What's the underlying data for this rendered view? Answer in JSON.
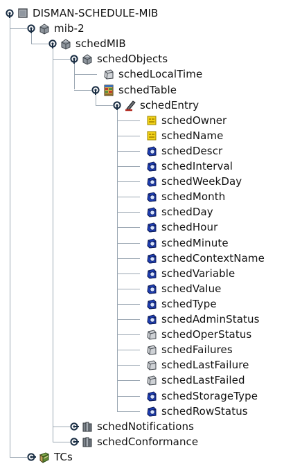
{
  "colors": {
    "connector": "#9aa6b2",
    "handle": "#1a2e44",
    "text": "#111111"
  },
  "tree": [
    {
      "label": "DISMAN-SCHEDULE-MIB",
      "depth": 0,
      "icon": "module-icon",
      "state": "expanded"
    },
    {
      "label": "mib-2",
      "depth": 1,
      "icon": "group-icon",
      "state": "expanded"
    },
    {
      "label": "schedMIB",
      "depth": 2,
      "icon": "group-icon",
      "state": "expanded"
    },
    {
      "label": "schedObjects",
      "depth": 3,
      "icon": "group-icon",
      "state": "expanded"
    },
    {
      "label": "schedLocalTime",
      "depth": 4,
      "icon": "scalar-icon",
      "state": "leaf"
    },
    {
      "label": "schedTable",
      "depth": 4,
      "icon": "table-icon",
      "state": "expanded"
    },
    {
      "label": "schedEntry",
      "depth": 5,
      "icon": "entry-icon",
      "state": "expanded"
    },
    {
      "label": "schedOwner",
      "depth": 6,
      "icon": "index-icon",
      "state": "leaf"
    },
    {
      "label": "schedName",
      "depth": 6,
      "icon": "index-icon",
      "state": "leaf"
    },
    {
      "label": "schedDescr",
      "depth": 6,
      "icon": "writable-column-icon",
      "state": "leaf"
    },
    {
      "label": "schedInterval",
      "depth": 6,
      "icon": "writable-column-icon",
      "state": "leaf"
    },
    {
      "label": "schedWeekDay",
      "depth": 6,
      "icon": "writable-column-icon",
      "state": "leaf"
    },
    {
      "label": "schedMonth",
      "depth": 6,
      "icon": "writable-column-icon",
      "state": "leaf"
    },
    {
      "label": "schedDay",
      "depth": 6,
      "icon": "writable-column-icon",
      "state": "leaf"
    },
    {
      "label": "schedHour",
      "depth": 6,
      "icon": "writable-column-icon",
      "state": "leaf"
    },
    {
      "label": "schedMinute",
      "depth": 6,
      "icon": "writable-column-icon",
      "state": "leaf"
    },
    {
      "label": "schedContextName",
      "depth": 6,
      "icon": "writable-column-icon",
      "state": "leaf"
    },
    {
      "label": "schedVariable",
      "depth": 6,
      "icon": "writable-column-icon",
      "state": "leaf"
    },
    {
      "label": "schedValue",
      "depth": 6,
      "icon": "writable-column-icon",
      "state": "leaf"
    },
    {
      "label": "schedType",
      "depth": 6,
      "icon": "writable-column-icon",
      "state": "leaf"
    },
    {
      "label": "schedAdminStatus",
      "depth": 6,
      "icon": "writable-column-icon",
      "state": "leaf"
    },
    {
      "label": "schedOperStatus",
      "depth": 6,
      "icon": "readonly-column-icon",
      "state": "leaf"
    },
    {
      "label": "schedFailures",
      "depth": 6,
      "icon": "readonly-column-icon",
      "state": "leaf"
    },
    {
      "label": "schedLastFailure",
      "depth": 6,
      "icon": "readonly-column-icon",
      "state": "leaf"
    },
    {
      "label": "schedLastFailed",
      "depth": 6,
      "icon": "readonly-column-icon",
      "state": "leaf"
    },
    {
      "label": "schedStorageType",
      "depth": 6,
      "icon": "writable-column-icon",
      "state": "leaf"
    },
    {
      "label": "schedRowStatus",
      "depth": 6,
      "icon": "writable-column-icon",
      "state": "leaf"
    },
    {
      "label": "schedNotifications",
      "depth": 3,
      "icon": "folder-group-icon",
      "state": "collapsed"
    },
    {
      "label": "schedConformance",
      "depth": 3,
      "icon": "folder-group-icon",
      "state": "collapsed"
    },
    {
      "label": "TCs",
      "depth": 1,
      "icon": "tc-book-icon",
      "state": "collapsed"
    }
  ]
}
